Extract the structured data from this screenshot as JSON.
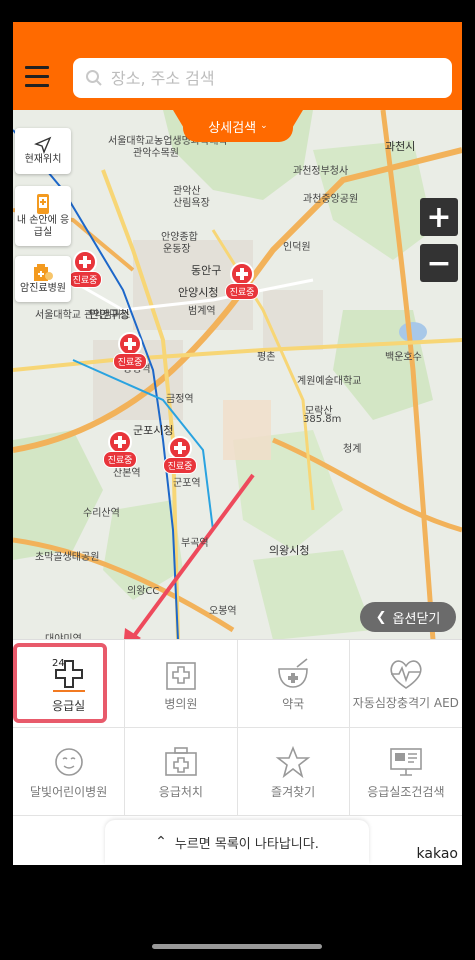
{
  "header": {
    "search_placeholder": "장소, 주소 검색",
    "detail_search": "상세검색"
  },
  "side_buttons": {
    "current_location": "현재위치",
    "emergency_hand": "내 손안에 응급실",
    "cancer_hospital": "암진료병원"
  },
  "zoom": {
    "in": "+",
    "out": "−"
  },
  "marker_tag": "진료중",
  "map_labels": {
    "l1": "서울대학교농업생명과학대학",
    "l2": "관악수목원",
    "l3": "관악산",
    "l4": "산림욕장",
    "l5": "안양종합",
    "l6": "운동장",
    "l7": "동안구",
    "l8": "안양시청",
    "l9": "범계역",
    "l10": "만안구청",
    "l11": "평촌",
    "l12": "금정역",
    "l13": "군포시청",
    "l14": "산본역",
    "l15": "의왕시청",
    "l16": "계원예술대학교",
    "l17": "모락산",
    "l18": "385.8m",
    "l19": "과천시",
    "l20": "과천정부청사",
    "l21": "백운호수",
    "l22": "청계",
    "l23": "수리산역",
    "l24": "초막골생태공원",
    "l25": "오봉역",
    "l26": "대야미역",
    "l27": "인덕원",
    "l28": "서울대학교 관악캠퍼스",
    "l29": "과천중앙공원",
    "l30": "군포역",
    "l31": "의왕CC",
    "l32": "당정역",
    "l33": "부곡역"
  },
  "option_close": "옵션닫기",
  "grid": [
    {
      "label": "응급실",
      "icon": "emergency-room-icon"
    },
    {
      "label": "병의원",
      "icon": "hospital-icon"
    },
    {
      "label": "약국",
      "icon": "pharmacy-icon"
    },
    {
      "label": "자동심장충격기 AED",
      "icon": "aed-icon"
    },
    {
      "label": "달빛어린이병원",
      "icon": "moonlight-child-icon"
    },
    {
      "label": "응급처치",
      "icon": "first-aid-icon"
    },
    {
      "label": "즐겨찾기",
      "icon": "star-icon"
    },
    {
      "label": "응급실조건검색",
      "icon": "monitor-icon"
    }
  ],
  "grid_badge": "24",
  "list_toggle": "누르면 목록이 나타납니다.",
  "brand": "kakao"
}
